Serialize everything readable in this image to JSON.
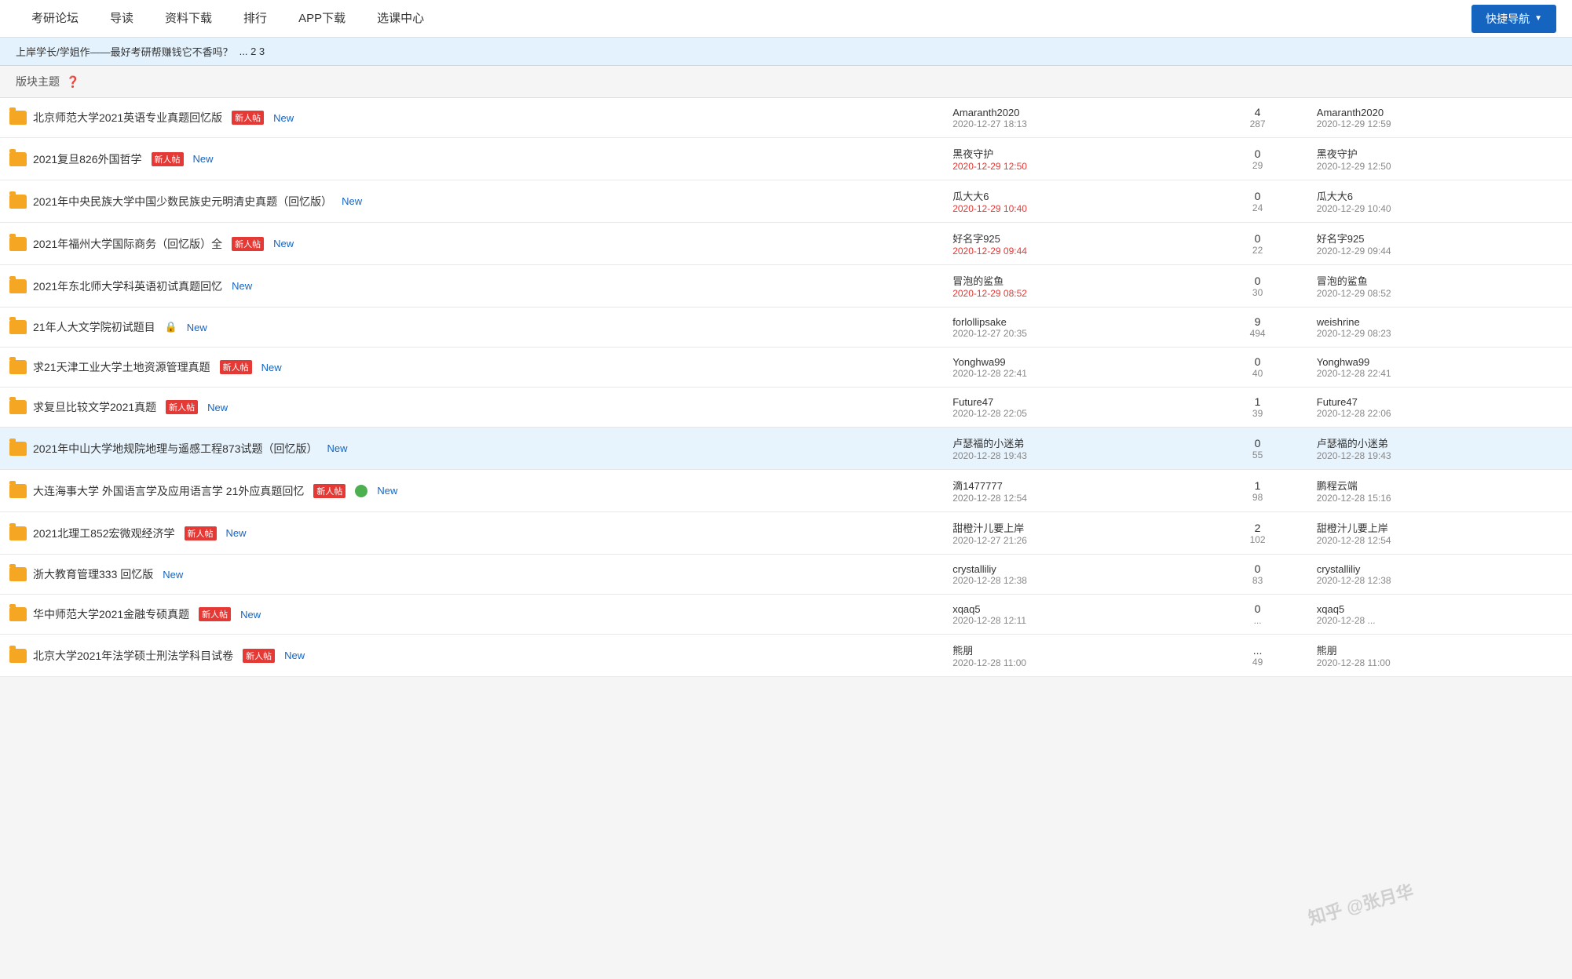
{
  "nav": {
    "items": [
      "考研论坛",
      "导读",
      "资料下载",
      "排行",
      "APP下载",
      "选课中心"
    ],
    "quick_nav": "快捷导航"
  },
  "top_banner": {
    "text": "上岸学长/学姐作——最好考研帮赚钱它不香吗？",
    "pages": "... 2 3"
  },
  "section": {
    "label": "版块主题",
    "icon": "❓"
  },
  "topics": [
    {
      "id": 1,
      "title": "北京师范大学2021英语专业真题回忆版",
      "badges": [
        "新人帖",
        "New"
      ],
      "highlighted": false,
      "author": "Amaranth2020",
      "author_time": "2020-12-27 18:13",
      "author_time_red": false,
      "replies": "4",
      "views": "287",
      "last_user": "Amaranth2020",
      "last_time": "2020-12-29 12:59",
      "last_time_red": false
    },
    {
      "id": 2,
      "title": "2021复旦826外国哲学",
      "badges": [
        "新人帖",
        "New"
      ],
      "highlighted": false,
      "author": "黑夜守护",
      "author_time": "2020-12-29 12:50",
      "author_time_red": true,
      "replies": "0",
      "views": "29",
      "last_user": "黑夜守护",
      "last_time": "2020-12-29 12:50",
      "last_time_red": false
    },
    {
      "id": 3,
      "title": "2021年中央民族大学中国少数民族史元明清史真题（回忆版）",
      "badges": [
        "New"
      ],
      "highlighted": false,
      "author": "瓜大大6",
      "author_time": "2020-12-29 10:40",
      "author_time_red": true,
      "replies": "0",
      "views": "24",
      "last_user": "瓜大大6",
      "last_time": "2020-12-29 10:40",
      "last_time_red": false
    },
    {
      "id": 4,
      "title": "2021年福州大学国际商务（回忆版）全",
      "badges": [
        "新人帖",
        "New"
      ],
      "highlighted": false,
      "author": "好名字925",
      "author_time": "2020-12-29 09:44",
      "author_time_red": true,
      "replies": "0",
      "views": "22",
      "last_user": "好名字925",
      "last_time": "2020-12-29 09:44",
      "last_time_red": false
    },
    {
      "id": 5,
      "title": "2021年东北师大学科英语初试真题回忆",
      "badges": [
        "New"
      ],
      "highlighted": false,
      "author": "冒泡的鲨鱼",
      "author_time": "2020-12-29 08:52",
      "author_time_red": true,
      "replies": "0",
      "views": "30",
      "last_user": "冒泡的鲨鱼",
      "last_time": "2020-12-29 08:52",
      "last_time_red": false
    },
    {
      "id": 6,
      "title": "21年人大文学院初试题目",
      "badges": [
        "🔒",
        "New"
      ],
      "highlighted": false,
      "author": "forlollipsake",
      "author_time": "2020-12-27 20:35",
      "author_time_red": false,
      "replies": "9",
      "views": "494",
      "last_user": "weishrine",
      "last_time": "2020-12-29 08:23",
      "last_time_red": false
    },
    {
      "id": 7,
      "title": "求21天津工业大学土地资源管理真题",
      "badges": [
        "新人帖",
        "New"
      ],
      "highlighted": false,
      "author": "Yonghwa99",
      "author_time": "2020-12-28 22:41",
      "author_time_red": false,
      "replies": "0",
      "views": "40",
      "last_user": "Yonghwa99",
      "last_time": "2020-12-28 22:41",
      "last_time_red": false
    },
    {
      "id": 8,
      "title": "求复旦比较文学2021真题",
      "badges": [
        "新人帖",
        "New"
      ],
      "highlighted": false,
      "author": "Future47",
      "author_time": "2020-12-28 22:05",
      "author_time_red": false,
      "replies": "1",
      "views": "39",
      "last_user": "Future47",
      "last_time": "2020-12-28 22:06",
      "last_time_red": false
    },
    {
      "id": 9,
      "title": "2021年中山大学地规院地理与遥感工程873试题（回忆版）",
      "badges": [
        "New"
      ],
      "highlighted": true,
      "author": "卢瑟福的小迷弟",
      "author_time": "2020-12-28 19:43",
      "author_time_red": false,
      "replies": "0",
      "views": "55",
      "last_user": "卢瑟福的小迷弟",
      "last_time": "2020-12-28 19:43",
      "last_time_red": false
    },
    {
      "id": 10,
      "title": "大连海事大学 外国语言学及应用语言学 21外应真题回忆",
      "badges": [
        "新人帖",
        "👤",
        "New"
      ],
      "highlighted": false,
      "author": "滴1477777",
      "author_time": "2020-12-28 12:54",
      "author_time_red": false,
      "replies": "1",
      "views": "98",
      "last_user": "鹏程云端",
      "last_time": "2020-12-28 15:16",
      "last_time_red": false
    },
    {
      "id": 11,
      "title": "2021北理工852宏微观经济学",
      "badges": [
        "新人帖",
        "New"
      ],
      "highlighted": false,
      "author": "甜橙汁儿要上岸",
      "author_time": "2020-12-27 21:26",
      "author_time_red": false,
      "replies": "2",
      "views": "102",
      "last_user": "甜橙汁儿要上岸",
      "last_time": "2020-12-28 12:54",
      "last_time_red": false
    },
    {
      "id": 12,
      "title": "浙大教育管理333 回忆版",
      "badges": [
        "New"
      ],
      "highlighted": false,
      "author": "crystalliliy",
      "author_time": "2020-12-28 12:38",
      "author_time_red": false,
      "replies": "0",
      "views": "83",
      "last_user": "crystalliliy",
      "last_time": "2020-12-28 12:38",
      "last_time_red": false
    },
    {
      "id": 13,
      "title": "华中师范大学2021金融专硕真题",
      "badges": [
        "新人帖",
        "New"
      ],
      "highlighted": false,
      "author": "xqaq5",
      "author_time": "2020-12-28 12:11",
      "author_time_red": false,
      "replies": "0",
      "views": "...",
      "last_user": "xqaq5",
      "last_time": "2020-12-28 ...",
      "last_time_red": false
    },
    {
      "id": 14,
      "title": "北京大学2021年法学硕士刑法学科目试卷",
      "badges": [
        "新人帖",
        "New"
      ],
      "highlighted": false,
      "author": "熊朋",
      "author_time": "2020-12-28 11:00",
      "author_time_red": false,
      "replies": "...",
      "views": "49",
      "last_user": "熊朋",
      "last_time": "2020-12-28 11:00",
      "last_time_red": false
    }
  ],
  "watermark": "知乎 @张月华"
}
